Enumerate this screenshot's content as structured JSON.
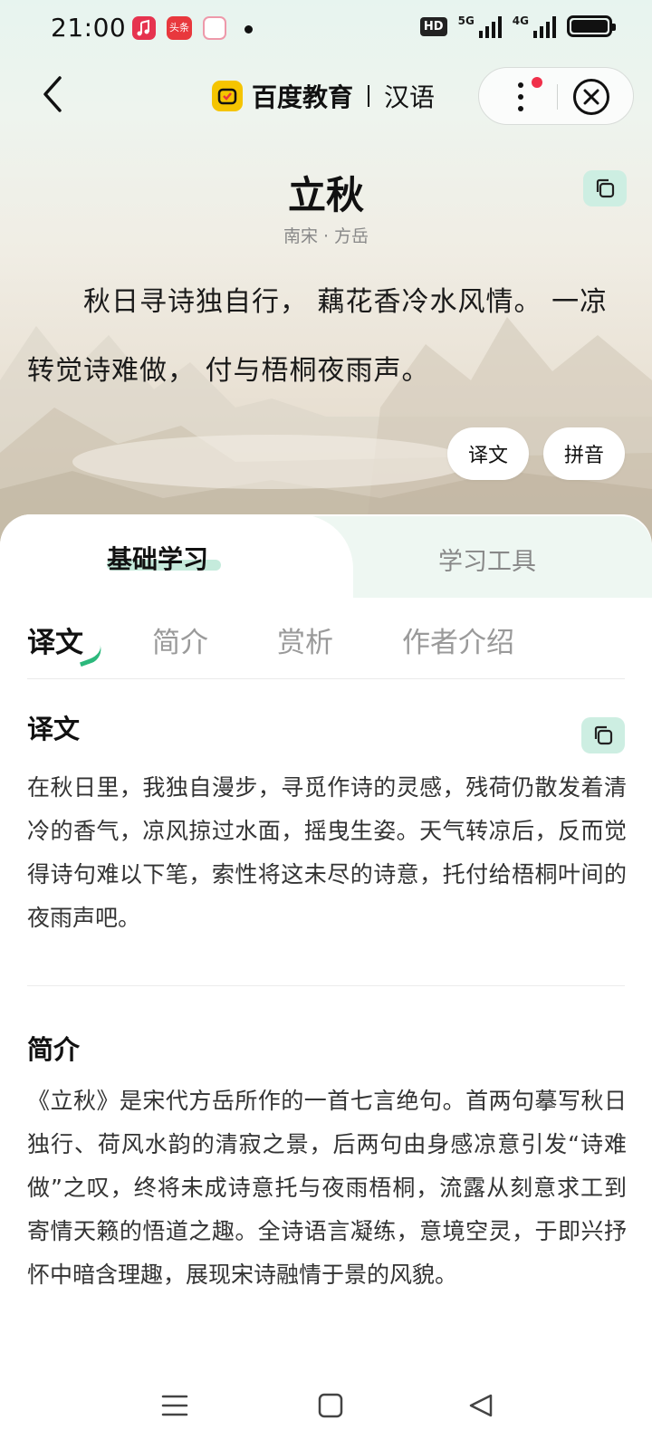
{
  "status_bar": {
    "time": "21:00",
    "toutiao_label": "头条",
    "hd_label": "HD",
    "net_5g": "5G",
    "net_4g": "4G",
    "battery_level": 1.0
  },
  "nav": {
    "brand_name": "百度教育",
    "brand_sub": "汉语"
  },
  "poem": {
    "title": "立秋",
    "author": "南宋 · 方岳",
    "body": "秋日寻诗独自行， 藕花香冷水风情。 一凉转觉诗难做， 付与梧桐夜雨声。",
    "btn_translate": "译文",
    "btn_pinyin": "拼音"
  },
  "main_tabs": {
    "basic": "基础学习",
    "tools": "学习工具"
  },
  "sub_tabs": [
    "译文",
    "简介",
    "赏析",
    "作者介绍"
  ],
  "sections": {
    "translation": {
      "title": "译文",
      "text": "在秋日里，我独自漫步，寻觅作诗的灵感，残荷仍散发着清冷的香气，凉风掠过水面，摇曳生姿。天气转凉后，反而觉得诗句难以下笔，索性将这未尽的诗意，托付给梧桐叶间的夜雨声吧。"
    },
    "intro": {
      "title": "简介",
      "text": "《立秋》是宋代方岳所作的一首七言绝句。首两句摹写秋日独行、荷风水韵的清寂之景，后两句由身感凉意引发“诗难做”之叹，终将未成诗意托与夜雨梧桐，流露从刻意求工到寄情天籁的悟道之趣。全诗语言凝练，意境空灵，于即兴抒怀中暗含理趣，展现宋诗融情于景的风貌。"
    }
  },
  "colors": {
    "accent_green": "#2cb87c",
    "copy_btn_bg": "#cdeee2",
    "badge_red": "#f0304a",
    "brand_yellow": "#f5c400"
  }
}
